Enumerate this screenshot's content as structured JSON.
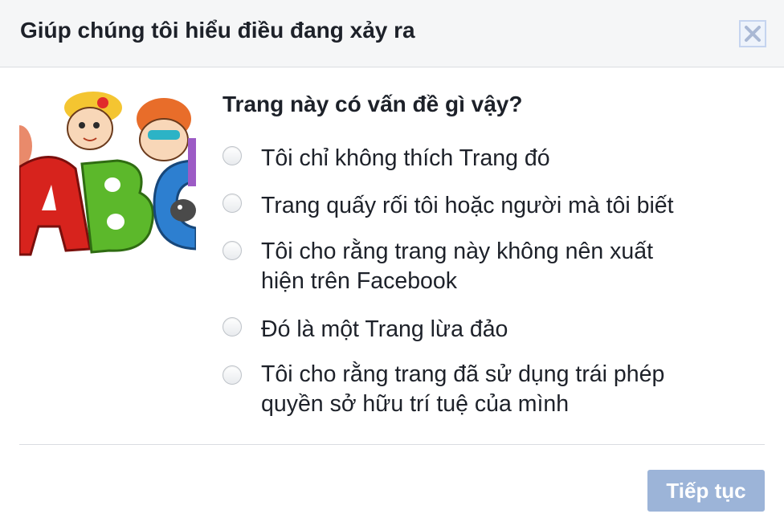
{
  "dialog": {
    "title": "Giúp chúng tôi hiểu điều đang xảy ra",
    "close_icon": "close-icon"
  },
  "thumbnail": {
    "image": "abc-letters-cartoon-kids",
    "letters": "ABC"
  },
  "question": "Trang này có vấn đề gì vậy?",
  "options": [
    {
      "line1": "Tôi chỉ không thích Trang đó",
      "line2": "",
      "selected": false
    },
    {
      "line1": "Trang quấy rối tôi hoặc người mà tôi biết",
      "line2": "",
      "selected": false
    },
    {
      "line1": "Tôi cho rằng trang này không nên xuất",
      "line2": "hiện trên Facebook",
      "selected": false
    },
    {
      "line1": "Đó là một Trang lừa đảo",
      "line2": "",
      "selected": false
    },
    {
      "line1": "Tôi cho rằng trang đã sử dụng trái phép",
      "line2": "quyền sở hữu trí tuệ của mình",
      "selected": false
    }
  ],
  "footer": {
    "continue_label": "Tiếp tục",
    "continue_enabled": false
  },
  "colors": {
    "header_bg": "#f5f6f7",
    "button_disabled": "#9cb4d8",
    "text": "#1d2129"
  }
}
